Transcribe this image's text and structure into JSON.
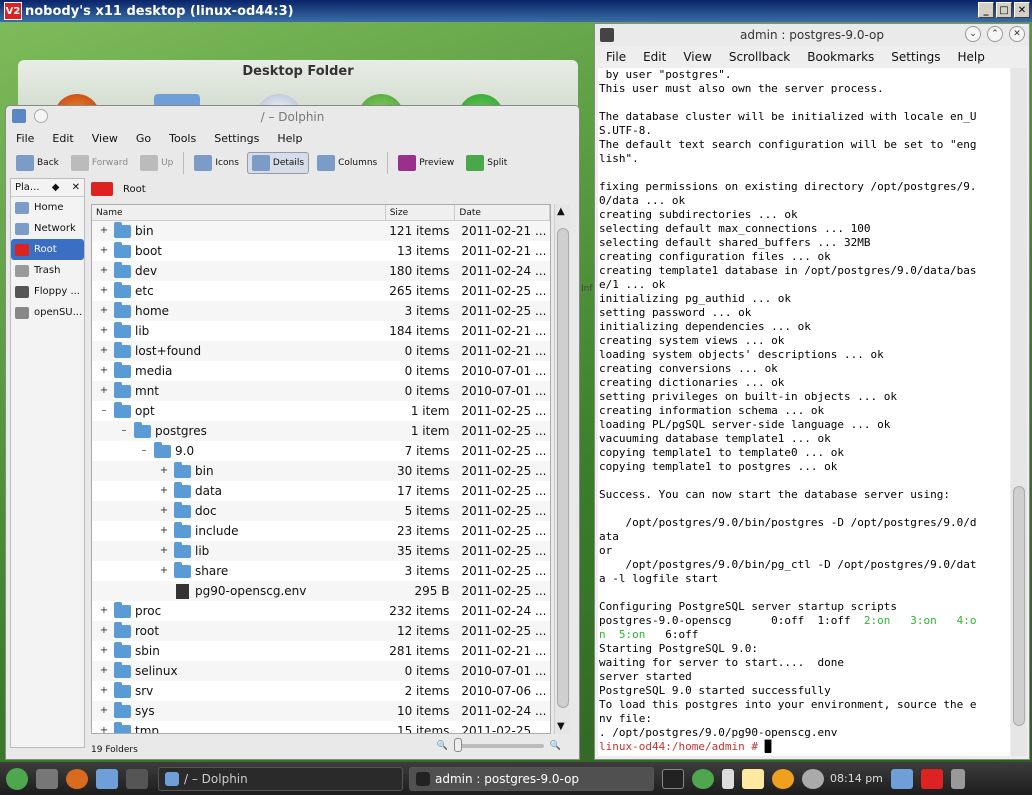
{
  "vnc": {
    "title": "nobody's x11 desktop (linux-od44:3)",
    "logo": "V2"
  },
  "desktop": {
    "folder_title": "Desktop Folder"
  },
  "dolphin": {
    "title": "/ – Dolphin",
    "menu": [
      "File",
      "Edit",
      "View",
      "Go",
      "Tools",
      "Settings",
      "Help"
    ],
    "toolbar": {
      "back": "Back",
      "forward": "Forward",
      "up": "Up",
      "icons": "Icons",
      "details": "Details",
      "columns": "Columns",
      "preview": "Preview",
      "split": "Split"
    },
    "places_header": "Pla...",
    "places": [
      "Home",
      "Network",
      "Root",
      "Trash",
      "Floppy ...",
      "openSU..."
    ],
    "breadcrumb": "Root",
    "columns": {
      "name": "Name",
      "size": "Size",
      "date": "Date"
    },
    "rows": [
      {
        "tw": "+",
        "name": "bin",
        "size": "121 items",
        "date": "2011-02-21 ...",
        "depth": 0
      },
      {
        "tw": "+",
        "name": "boot",
        "size": "13 items",
        "date": "2011-02-21 ...",
        "depth": 0
      },
      {
        "tw": "+",
        "name": "dev",
        "size": "180 items",
        "date": "2011-02-24 ...",
        "depth": 0
      },
      {
        "tw": "+",
        "name": "etc",
        "size": "265 items",
        "date": "2011-02-25 ...",
        "depth": 0
      },
      {
        "tw": "+",
        "name": "home",
        "size": "3 items",
        "date": "2011-02-25 ...",
        "depth": 0
      },
      {
        "tw": "+",
        "name": "lib",
        "size": "184 items",
        "date": "2011-02-21 ...",
        "depth": 0
      },
      {
        "tw": "+",
        "name": "lost+found",
        "size": "0 items",
        "date": "2011-02-21 ...",
        "depth": 0
      },
      {
        "tw": "+",
        "name": "media",
        "size": "0 items",
        "date": "2010-07-01 ...",
        "depth": 0
      },
      {
        "tw": "+",
        "name": "mnt",
        "size": "0 items",
        "date": "2010-07-01 ...",
        "depth": 0
      },
      {
        "tw": "–",
        "name": "opt",
        "size": "1 item",
        "date": "2011-02-25 ...",
        "depth": 0
      },
      {
        "tw": "–",
        "name": "postgres",
        "size": "1 item",
        "date": "2011-02-25 ...",
        "depth": 1
      },
      {
        "tw": "–",
        "name": "9.0",
        "size": "7 items",
        "date": "2011-02-25 ...",
        "depth": 2
      },
      {
        "tw": "+",
        "name": "bin",
        "size": "30 items",
        "date": "2011-02-25 ...",
        "depth": 3
      },
      {
        "tw": "+",
        "name": "data",
        "size": "17 items",
        "date": "2011-02-25 ...",
        "depth": 3
      },
      {
        "tw": "+",
        "name": "doc",
        "size": "5 items",
        "date": "2011-02-25 ...",
        "depth": 3
      },
      {
        "tw": "+",
        "name": "include",
        "size": "23 items",
        "date": "2011-02-25 ...",
        "depth": 3
      },
      {
        "tw": "+",
        "name": "lib",
        "size": "35 items",
        "date": "2011-02-25 ...",
        "depth": 3
      },
      {
        "tw": "+",
        "name": "share",
        "size": "3 items",
        "date": "2011-02-25 ...",
        "depth": 3
      },
      {
        "tw": "",
        "name": "pg90-openscg.env",
        "size": "295 B",
        "date": "2011-02-25 ...",
        "depth": 3,
        "file": true
      },
      {
        "tw": "+",
        "name": "proc",
        "size": "232 items",
        "date": "2011-02-24 ...",
        "depth": 0
      },
      {
        "tw": "+",
        "name": "root",
        "size": "12 items",
        "date": "2011-02-25 ...",
        "depth": 0
      },
      {
        "tw": "+",
        "name": "sbin",
        "size": "281 items",
        "date": "2011-02-21 ...",
        "depth": 0
      },
      {
        "tw": "+",
        "name": "selinux",
        "size": "0 items",
        "date": "2010-07-01 ...",
        "depth": 0
      },
      {
        "tw": "+",
        "name": "srv",
        "size": "2 items",
        "date": "2010-07-06 ...",
        "depth": 0
      },
      {
        "tw": "+",
        "name": "sys",
        "size": "10 items",
        "date": "2011-02-24 ...",
        "depth": 0
      },
      {
        "tw": "+",
        "name": "tmp",
        "size": "15 items",
        "date": "2011-02-25 ...",
        "depth": 0
      }
    ],
    "status": "19 Folders",
    "zoom_level": 0,
    "info_label": "Inf"
  },
  "konsole": {
    "title": "admin : postgres-9.0-op",
    "menu": [
      "File",
      "Edit",
      "View",
      "Scrollback",
      "Bookmarks",
      "Settings",
      "Help"
    ],
    "lines": [
      " by user \"postgres\".",
      "This user must also own the server process.",
      "",
      "The database cluster will be initialized with locale en_U",
      "S.UTF-8.",
      "The default text search configuration will be set to \"eng",
      "lish\".",
      "",
      "fixing permissions on existing directory /opt/postgres/9.",
      "0/data ... ok",
      "creating subdirectories ... ok",
      "selecting default max_connections ... 100",
      "selecting default shared_buffers ... 32MB",
      "creating configuration files ... ok",
      "creating template1 database in /opt/postgres/9.0/data/bas",
      "e/1 ... ok",
      "initializing pg_authid ... ok",
      "setting password ... ok",
      "initializing dependencies ... ok",
      "creating system views ... ok",
      "loading system objects' descriptions ... ok",
      "creating conversions ... ok",
      "creating dictionaries ... ok",
      "setting privileges on built-in objects ... ok",
      "creating information schema ... ok",
      "loading PL/pgSQL server-side language ... ok",
      "vacuuming database template1 ... ok",
      "copying template1 to template0 ... ok",
      "copying template1 to postgres ... ok",
      "",
      "Success. You can now start the database server using:",
      "",
      "    /opt/postgres/9.0/bin/postgres -D /opt/postgres/9.0/d",
      "ata",
      "or",
      "    /opt/postgres/9.0/bin/pg_ctl -D /opt/postgres/9.0/dat",
      "a -l logfile start",
      "",
      "Configuring PostgreSQL server startup scripts"
    ],
    "runlevel_line": {
      "prefix": "postgres-9.0-openscg      0:off  1:off  ",
      "on2": "2:on",
      "gap1": "   ",
      "on3": "3:on",
      "gap2": "   ",
      "on4a": "4:o"
    },
    "runlevel_line2": {
      "on4b": "n",
      "gap": "  ",
      "on5": "5:on",
      "rest": "   6:off"
    },
    "lines_after": [
      "Starting PostgreSQL 9.0:",
      "waiting for server to start....  done",
      "server started",
      "PostgreSQL 9.0 started successfully",
      "To load this postgres into your environment, source the e",
      "nv file:",
      ". /opt/postgres/9.0/pg90-openscg.env"
    ],
    "prompt": "linux-od44:/home/admin # "
  },
  "taskbar": {
    "tasks": [
      "/ – Dolphin",
      "admin : postgres-9.0-op"
    ],
    "clock": "08:14 pm"
  }
}
